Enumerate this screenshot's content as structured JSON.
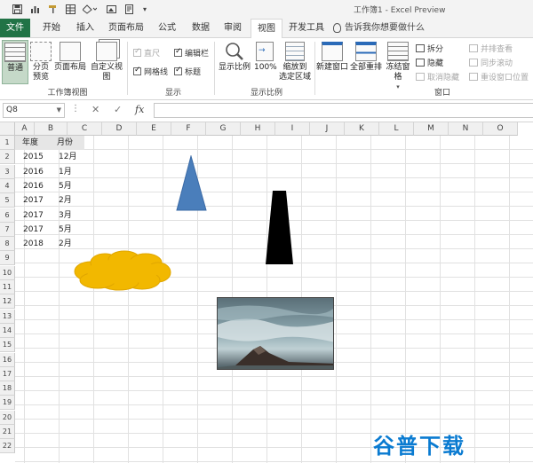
{
  "app": {
    "title": "工作簿1 - Excel Preview"
  },
  "tabs": [
    {
      "label": "文件",
      "kind": "file"
    },
    {
      "label": "开始"
    },
    {
      "label": "插入"
    },
    {
      "label": "页面布局"
    },
    {
      "label": "公式"
    },
    {
      "label": "数据"
    },
    {
      "label": "审阅"
    },
    {
      "label": "视图",
      "active": true
    },
    {
      "label": "开发工具"
    }
  ],
  "tell_me": "告诉我你想要做什么",
  "ribbon": {
    "workbook_views": {
      "label": "工作簿视图",
      "normal": "普通",
      "page_break": "分页\n预览",
      "page_layout": "页面布局",
      "custom_views": "自定义视图"
    },
    "show": {
      "label": "显示",
      "ruler": "直尺",
      "formula_bar": "编辑栏",
      "gridlines": "网格线",
      "headings": "标题"
    },
    "zoom": {
      "label": "显示比例",
      "zoom": "显示比例",
      "hundred": "100%",
      "zoom_selection": "缩放到\n选定区域"
    },
    "window": {
      "label": "窗口",
      "new_window": "新建窗口",
      "arrange_all": "全部重排",
      "freeze_panes": "冻结窗格",
      "split": "拆分",
      "hide": "隐藏",
      "unhide": "取消隐藏",
      "side_by_side": "并排查看",
      "sync_scroll": "同步滚动",
      "reset_position": "重设窗口位置"
    }
  },
  "formula_bar": {
    "name_box": "Q8",
    "cancel": "✕",
    "enter": "✓",
    "fx": "fx"
  },
  "columns": [
    "A",
    "B",
    "C",
    "D",
    "E",
    "F",
    "G",
    "H",
    "I",
    "J",
    "K",
    "L",
    "M",
    "N",
    "O"
  ],
  "rows": [
    "1",
    "2",
    "3",
    "4",
    "5",
    "6",
    "7",
    "8",
    "9",
    "10",
    "11",
    "12",
    "13",
    "14",
    "15",
    "16",
    "17",
    "18",
    "19",
    "20",
    "21",
    "22"
  ],
  "table": {
    "headers": [
      "年度",
      "月份"
    ],
    "rows": [
      [
        "2015",
        "12月"
      ],
      [
        "2016",
        "1月"
      ],
      [
        "2016",
        "5月"
      ],
      [
        "2017",
        "2月"
      ],
      [
        "2017",
        "3月"
      ],
      [
        "2017",
        "5月"
      ],
      [
        "2018",
        "2月"
      ]
    ]
  },
  "shapes": {
    "triangle_color": "#4a7ebb",
    "trapezoid_color": "#000000",
    "cloud_color": "#f2b800",
    "cloud_outline": "#e0a600"
  },
  "watermark": "谷普下载",
  "colors": {
    "file_tab": "#217346",
    "active_view": "#c5d9c8"
  }
}
